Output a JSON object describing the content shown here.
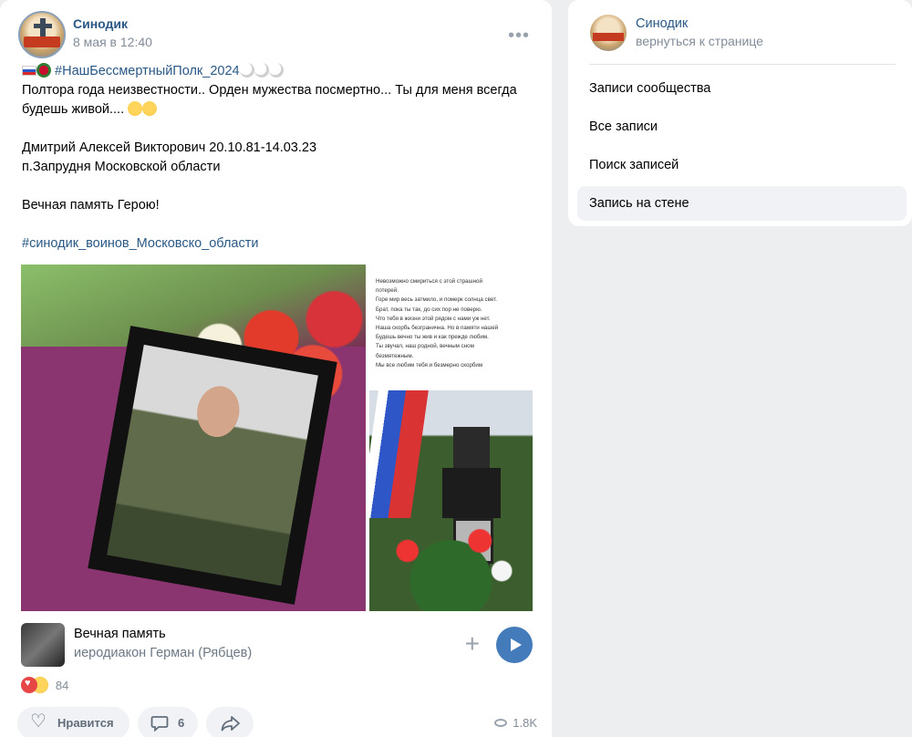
{
  "post": {
    "author": "Синодик",
    "date": "8 мая в 12:40",
    "more_label": "•••",
    "hashtag_line": "#НашБессмертныйПолк_2024",
    "text_line1": "Полтора года неизвестности.. Орден мужества посмертно... Ты для меня всегда",
    "text_line2": "будешь живой....",
    "text_line3": "Дмитрий Алексей Викторович 20.10.81-14.03.23",
    "text_line4": "п.Запрудня Московской области",
    "text_line5": "Вечная память Герою!",
    "hashtag_footer": "#синодик_воинов_Московско_области",
    "poem": [
      "Невозможно смириться с этой страшной",
      "потерей.",
      "Горе мир весь затмило, и померк солнца свет.",
      "Брат, пока ты так, до сих пор не поверю.",
      "Что тебя в жизни этой рядом с нами уж нет.",
      "Наша скорбь безгранична. Но в памяти нашей",
      "Будешь вечно ты жив и как прежде любим.",
      "Ты звучал, наш родной, вечным сном",
      "безмятежным.",
      "Мы все любим тебя и безмерно скорбим"
    ]
  },
  "audio": {
    "title": "Вечная память",
    "artist": "иеродиакон Герман (Рябцев)",
    "add_label": "+"
  },
  "reactions": {
    "count": "84"
  },
  "actions": {
    "like_label": "Нравится",
    "comments_count": "6",
    "views": "1.8K"
  },
  "sidebar": {
    "name": "Синодик",
    "back_label": "вернуться к странице",
    "items": [
      {
        "label": "Записи сообщества"
      },
      {
        "label": "Все записи"
      },
      {
        "label": "Поиск записей"
      },
      {
        "label": "Запись на стене"
      }
    ]
  },
  "colors": {
    "link": "#2a5885",
    "accent": "#447bba",
    "muted": "#818c99"
  }
}
